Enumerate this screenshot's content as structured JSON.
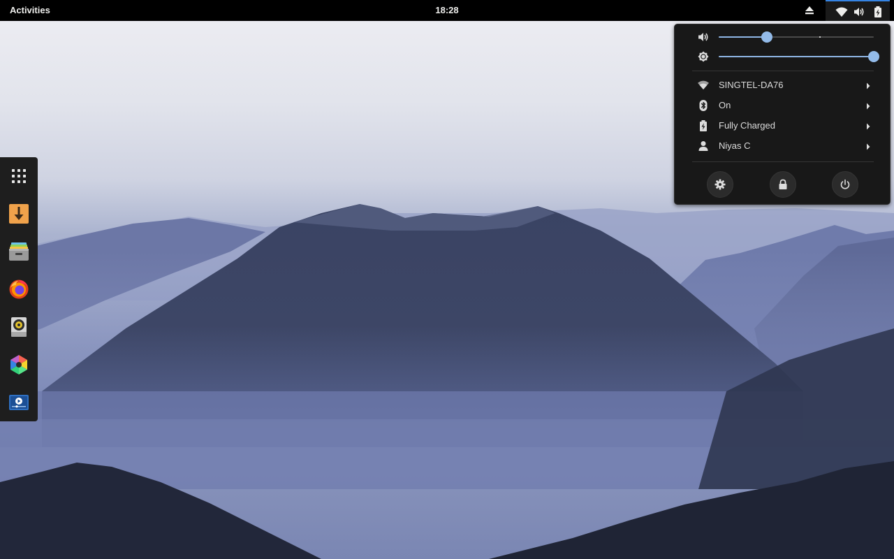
{
  "topbar": {
    "activities_label": "Activities",
    "clock": "18:28",
    "icons": [
      "eject-icon",
      "wifi-icon",
      "volume-icon",
      "battery-icon"
    ]
  },
  "dock": {
    "items": [
      {
        "name": "show-applications",
        "icon": "grid-icon"
      },
      {
        "name": "downloader",
        "icon": "download-arrow-icon"
      },
      {
        "name": "archive-manager",
        "icon": "file-cabinet-icon"
      },
      {
        "name": "firefox",
        "icon": "firefox-icon"
      },
      {
        "name": "rhythmbox",
        "icon": "speaker-icon"
      },
      {
        "name": "color-app",
        "icon": "hexagon-color-icon"
      },
      {
        "name": "screen-recorder",
        "icon": "video-player-icon"
      }
    ]
  },
  "system_menu": {
    "volume": {
      "icon": "volume-icon",
      "level": 0.31
    },
    "brightness": {
      "icon": "brightness-icon",
      "level": 1.0
    },
    "rows": [
      {
        "icon": "wifi-icon",
        "label": "SINGTEL-DA76"
      },
      {
        "icon": "bluetooth-icon",
        "label": "On"
      },
      {
        "icon": "battery-icon",
        "label": "Fully Charged"
      },
      {
        "icon": "user-icon",
        "label": "Niyas C"
      }
    ],
    "actions": [
      {
        "icon": "gear-icon",
        "name": "settings"
      },
      {
        "icon": "lock-icon",
        "name": "lock"
      },
      {
        "icon": "power-icon",
        "name": "power-off"
      }
    ]
  },
  "colors": {
    "panel_bg": "#000000",
    "menu_bg": "#181818",
    "accent": "#93bbe9",
    "text": "#dcdcdc"
  }
}
